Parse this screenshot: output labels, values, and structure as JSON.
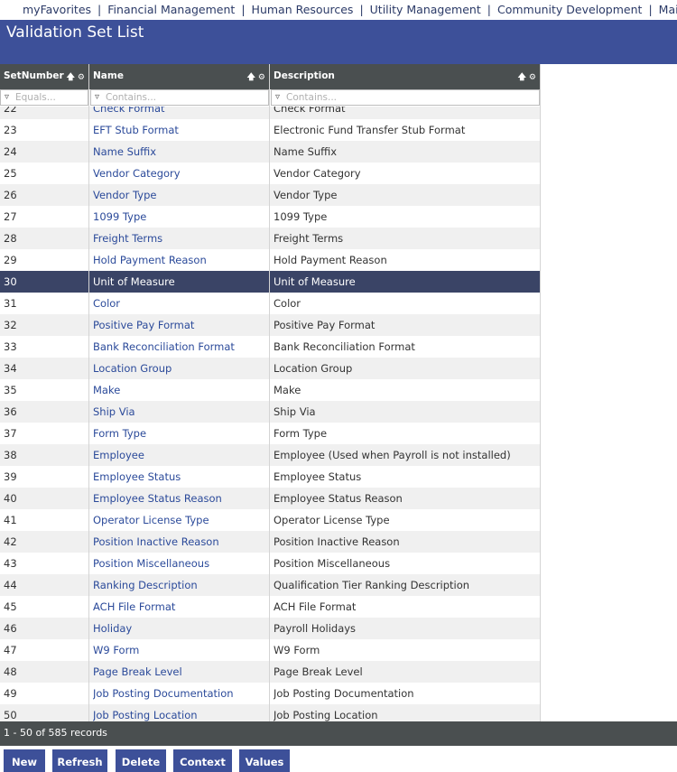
{
  "nav": {
    "items": [
      "myFavorites",
      "Financial Management",
      "Human Resources",
      "Utility Management",
      "Community Development",
      "Maintenance"
    ],
    "separator": "|"
  },
  "page": {
    "title": "Validation Set List"
  },
  "grid": {
    "columns": [
      {
        "label": "SetNumber",
        "sort_icon": "sort-up-icon",
        "settings_icon": "gear-icon"
      },
      {
        "label": "Name",
        "sort_icon": "sort-up-icon",
        "settings_icon": "gear-icon"
      },
      {
        "label": "Description",
        "sort_icon": "sort-up-icon",
        "settings_icon": "gear-icon"
      }
    ],
    "filters": [
      {
        "placeholder": "Equals...",
        "value": ""
      },
      {
        "placeholder": "Contains...",
        "value": ""
      },
      {
        "placeholder": "Contains...",
        "value": ""
      }
    ],
    "selected_set_number": "30",
    "rows": [
      [
        "22",
        "Check Format",
        "Check Format"
      ],
      [
        "23",
        "EFT Stub Format",
        "Electronic Fund Transfer Stub Format"
      ],
      [
        "24",
        "Name Suffix",
        "Name Suffix"
      ],
      [
        "25",
        "Vendor Category",
        "Vendor Category"
      ],
      [
        "26",
        "Vendor Type",
        "Vendor Type"
      ],
      [
        "27",
        "1099 Type",
        "1099 Type"
      ],
      [
        "28",
        "Freight Terms",
        "Freight Terms"
      ],
      [
        "29",
        "Hold Payment Reason",
        "Hold Payment Reason"
      ],
      [
        "30",
        "Unit of Measure",
        "Unit of Measure"
      ],
      [
        "31",
        "Color",
        "Color"
      ],
      [
        "32",
        "Positive Pay Format",
        "Positive Pay Format"
      ],
      [
        "33",
        "Bank Reconciliation Format",
        "Bank Reconciliation Format"
      ],
      [
        "34",
        "Location Group",
        "Location Group"
      ],
      [
        "35",
        "Make",
        "Make"
      ],
      [
        "36",
        "Ship Via",
        "Ship Via"
      ],
      [
        "37",
        "Form Type",
        "Form Type"
      ],
      [
        "38",
        "Employee",
        "Employee (Used when Payroll is not installed)"
      ],
      [
        "39",
        "Employee Status",
        "Employee Status"
      ],
      [
        "40",
        "Employee Status Reason",
        "Employee Status Reason"
      ],
      [
        "41",
        "Operator License Type",
        "Operator License Type"
      ],
      [
        "42",
        "Position Inactive Reason",
        "Position Inactive Reason"
      ],
      [
        "43",
        "Position Miscellaneous",
        "Position Miscellaneous"
      ],
      [
        "44",
        "Ranking Description",
        "Qualification Tier Ranking Description"
      ],
      [
        "45",
        "ACH File Format",
        "ACH File Format"
      ],
      [
        "46",
        "Holiday",
        "Payroll Holidays"
      ],
      [
        "47",
        "W9 Form",
        "W9 Form"
      ],
      [
        "48",
        "Page Break Level",
        "Page Break Level"
      ],
      [
        "49",
        "Job Posting Documentation",
        "Job Posting Documentation"
      ],
      [
        "50",
        "Job Posting Location",
        "Job Posting Location"
      ]
    ]
  },
  "footer": {
    "record_count": "1 - 50 of 585 records"
  },
  "buttons": {
    "new": "New",
    "refresh": "Refresh",
    "delete": "Delete",
    "context": "Context",
    "values": "Values"
  },
  "colors": {
    "header_blue": "#3d5099",
    "grid_header": "#4a4f50",
    "selected_row": "#3a4466",
    "link": "#2b4a9a"
  }
}
